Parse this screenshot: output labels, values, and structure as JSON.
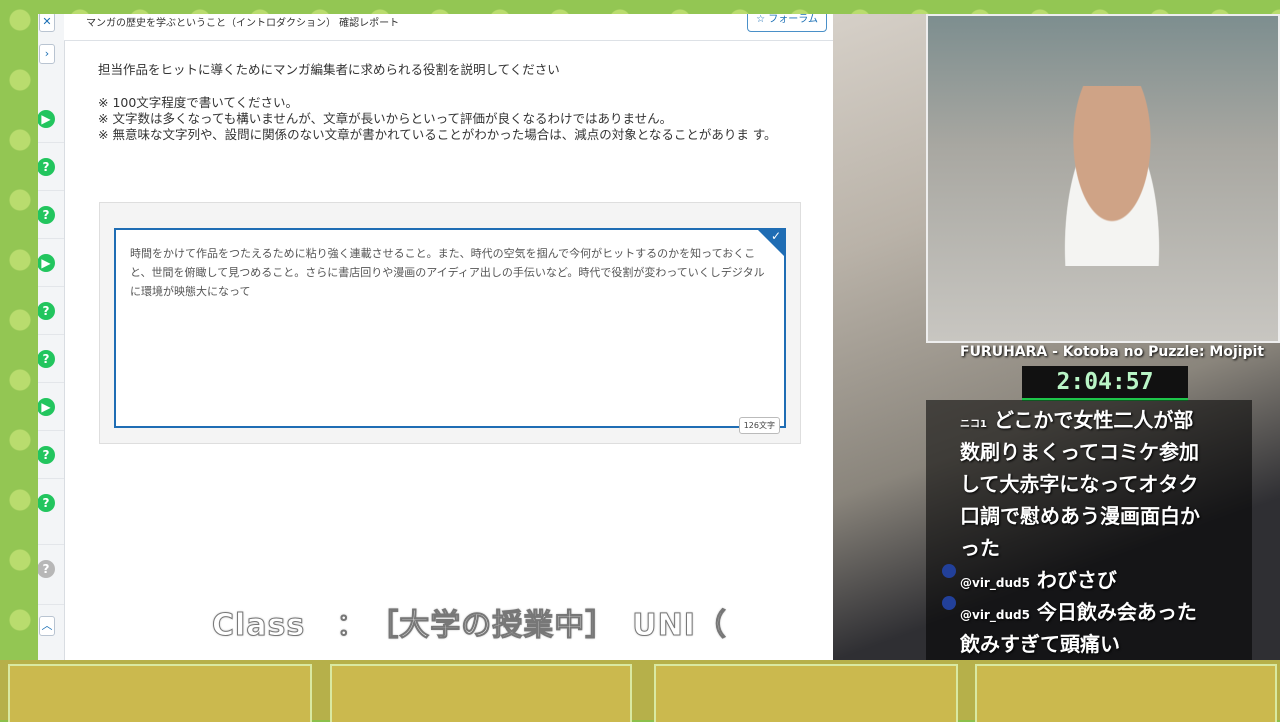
{
  "header": {
    "title": "マンガの歴史を学ぶということ（イントロダクション） 確認レポート",
    "forum_button": "フォーラム"
  },
  "question": {
    "prompt": "担当作品をヒットに導くためにマンガ編集者に求められる役割を説明してください",
    "notes": [
      "※ 100文字程度で書いてください。",
      "※ 文字数は多くなっても構いませんが、文章が長いからといって評価が良くなるわけではありません。",
      "※ 無意味な文字列や、設問に関係のない文章が書かれていることがわかった場合は、減点の対象となることがありま す。"
    ]
  },
  "answer": {
    "text": "時間をかけて作品をつたえるために粘り強く連載させること。また、時代の空気を掴んで今何がヒットするのかを知っておくこと、世間を俯瞰して見つめること。さらに書店回りや漫画のアイディア出しの手伝いなど。時代で役割が変わっていくしデジタルに環境が映態大になって",
    "char_count": "126文字"
  },
  "ticker_text": "Class　：　［大学の授業中］　UNI（",
  "stream": {
    "title": "FURUHARA - Kotoba no Puzzle: Mojipit",
    "timer": "2:04:57"
  },
  "chat": [
    {
      "badge": "ニコ1",
      "message_lines": [
        "どこかで女性二人が部",
        "数刷りまくってコミケ参加",
        "して大赤字になってオタク",
        "口調で慰めあう漫画面白か",
        "った"
      ]
    },
    {
      "user": "@vir_dud5",
      "message": "わびさび"
    },
    {
      "user": "@vir_dud5",
      "message_lines": [
        "今日飲み会あった",
        "飲みすぎて頭痛い"
      ]
    }
  ],
  "icons": {
    "close": "close-icon",
    "chevron": "chevron-right-icon",
    "play": "play-icon",
    "question": "question-icon",
    "check": "check-icon"
  }
}
